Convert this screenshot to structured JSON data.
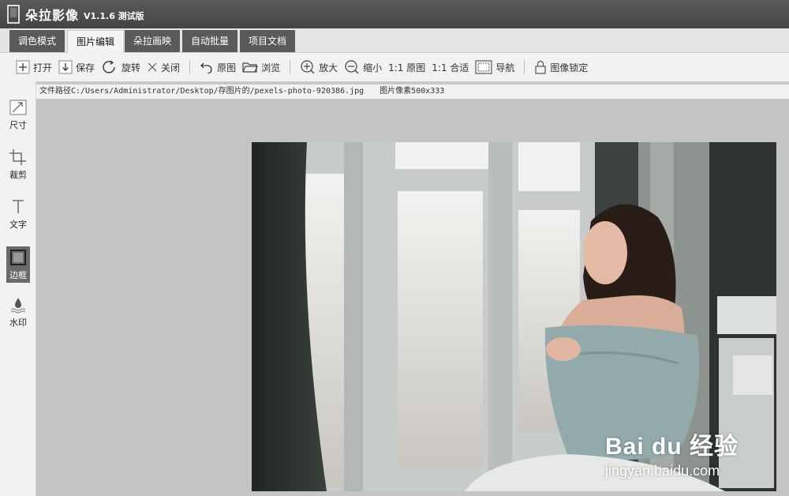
{
  "app": {
    "name": "朵拉影像",
    "version": "V1.1.6 测试版"
  },
  "tabs": [
    {
      "label": "调色模式"
    },
    {
      "label": "图片编辑",
      "active": true
    },
    {
      "label": "朵拉画映"
    },
    {
      "label": "自动批量"
    },
    {
      "label": "项目文档"
    }
  ],
  "toolbar": {
    "open": "打开",
    "save": "保存",
    "rotate": "旋转",
    "close": "关闭",
    "original": "原图",
    "browse": "浏览",
    "zoom_in": "放大",
    "zoom_out": "缩小",
    "one_to_one": "1:1 原图",
    "fit": "1:1 合适",
    "navigate": "导航",
    "lock": "图像锁定"
  },
  "sidebar": {
    "items": [
      {
        "label": "尺寸",
        "icon": "resize-icon"
      },
      {
        "label": "裁剪",
        "icon": "crop-icon"
      },
      {
        "label": "文字",
        "icon": "text-icon"
      },
      {
        "label": "边框",
        "icon": "border-icon",
        "active": true
      },
      {
        "label": "水印",
        "icon": "watermark-icon"
      }
    ]
  },
  "file": {
    "path": "文件路径C:/Users/Administrator/Desktop/存图片的/pexels-photo-920386.jpg",
    "pixels": "图片像素500x333"
  },
  "watermark": {
    "brand": "Bai du 经验",
    "url": "jingyan.baidu.com"
  },
  "colors": {
    "titlebar": "#4a4a4a",
    "tab_inactive": "#5a5a5a",
    "canvas": "#c4c4c4"
  }
}
